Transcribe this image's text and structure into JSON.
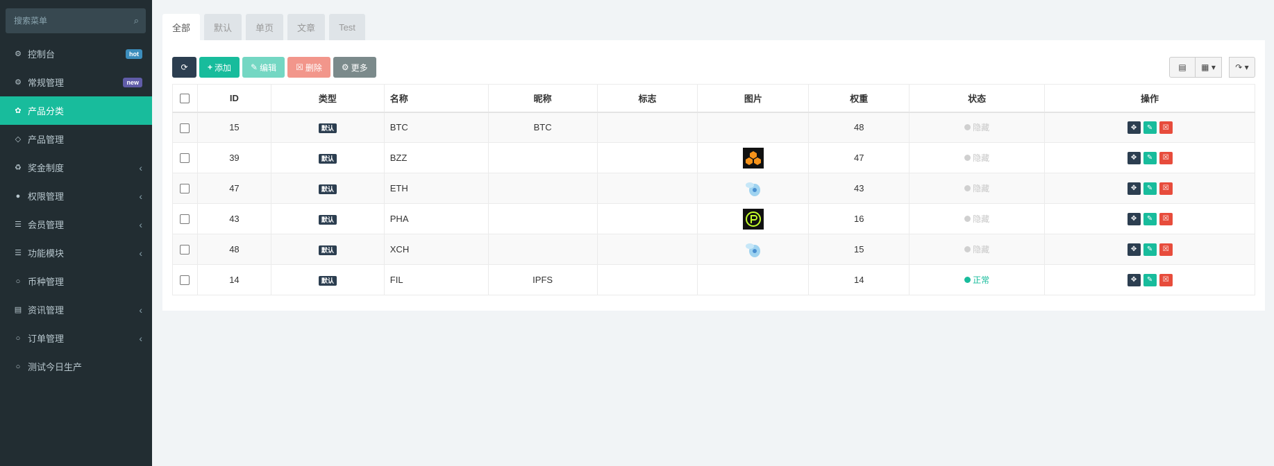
{
  "sidebar": {
    "search_placeholder": "搜索菜单",
    "items": [
      {
        "label": "控制台",
        "icon": "dashboard-icon",
        "badge": "hot"
      },
      {
        "label": "常规管理",
        "icon": "cogs-icon",
        "badge": "new"
      },
      {
        "label": "产品分类",
        "icon": "leaf-icon",
        "active": true
      },
      {
        "label": "产品管理",
        "icon": "diamond-icon"
      },
      {
        "label": "奖金制度",
        "icon": "recycle-icon",
        "expandable": true
      },
      {
        "label": "权限管理",
        "icon": "group-icon",
        "expandable": true
      },
      {
        "label": "会员管理",
        "icon": "list-icon",
        "expandable": true
      },
      {
        "label": "功能模块",
        "icon": "list-icon",
        "expandable": true
      },
      {
        "label": "币种管理",
        "icon": "circle-icon"
      },
      {
        "label": "资讯管理",
        "icon": "newspaper-icon",
        "expandable": true
      },
      {
        "label": "订单管理",
        "icon": "circle-icon",
        "expandable": true
      },
      {
        "label": "测试今日生产",
        "icon": "circle-icon"
      }
    ]
  },
  "tabs": [
    "全部",
    "默认",
    "单页",
    "文章",
    "Test"
  ],
  "toolbar": {
    "add": "添加",
    "edit": "编辑",
    "delete": "删除",
    "more": "更多"
  },
  "table": {
    "headers": [
      "ID",
      "类型",
      "名称",
      "昵称",
      "标志",
      "图片",
      "权重",
      "状态",
      "操作"
    ],
    "rows": [
      {
        "id": "15",
        "type": "默认",
        "name": "BTC",
        "nickname": "BTC",
        "flag": "",
        "image": "",
        "weight": "48",
        "status": "隐藏"
      },
      {
        "id": "39",
        "type": "默认",
        "name": "BZZ",
        "nickname": "",
        "flag": "",
        "image": "bzz-logo",
        "weight": "47",
        "status": "隐藏"
      },
      {
        "id": "47",
        "type": "默认",
        "name": "ETH",
        "nickname": "",
        "flag": "",
        "image": "eth-logo",
        "weight": "43",
        "status": "隐藏"
      },
      {
        "id": "43",
        "type": "默认",
        "name": "PHA",
        "nickname": "",
        "flag": "",
        "image": "pha-logo",
        "weight": "16",
        "status": "隐藏"
      },
      {
        "id": "48",
        "type": "默认",
        "name": "XCH",
        "nickname": "",
        "flag": "",
        "image": "xch-logo",
        "weight": "15",
        "status": "隐藏"
      },
      {
        "id": "14",
        "type": "默认",
        "name": "FIL",
        "nickname": "IPFS",
        "flag": "",
        "image": "",
        "weight": "14",
        "status": "正常"
      }
    ]
  },
  "colors": {
    "sidebar_bg": "#222d32",
    "accent": "#18bc9c",
    "danger": "#e74c3c",
    "dark": "#2c3e50"
  }
}
